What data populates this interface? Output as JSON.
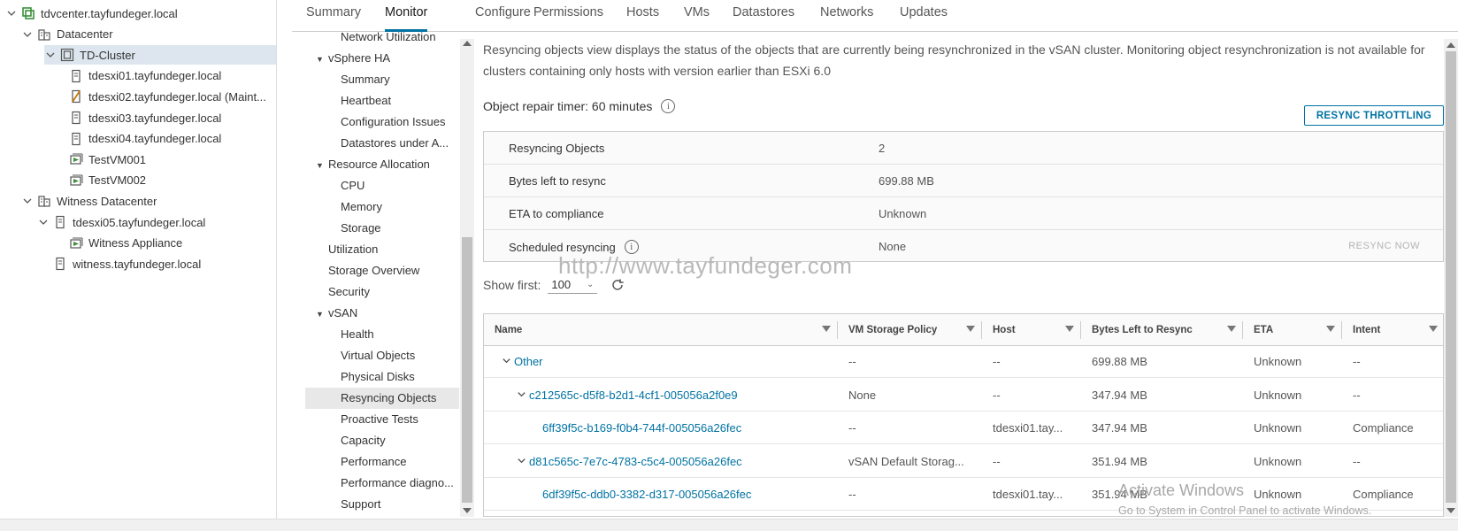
{
  "tree": [
    {
      "label": "tdvcenter.tayfundeger.local",
      "icon": "vcenter-icon",
      "level": 0,
      "toggle": "down"
    },
    {
      "label": "Datacenter",
      "icon": "datacenter-icon",
      "level": 1,
      "toggle": "down"
    },
    {
      "label": "TD-Cluster",
      "icon": "cluster-icon",
      "level": 2,
      "toggle": "down",
      "selected": true
    },
    {
      "label": "tdesxi01.tayfundeger.local",
      "icon": "host-icon",
      "level": 3
    },
    {
      "label": "tdesxi02.tayfundeger.local (Maint...",
      "icon": "host-maintenance-icon",
      "level": 3
    },
    {
      "label": "tdesxi03.tayfundeger.local",
      "icon": "host-icon",
      "level": 3
    },
    {
      "label": "tdesxi04.tayfundeger.local",
      "icon": "host-icon",
      "level": 3
    },
    {
      "label": "TestVM001",
      "icon": "vm-running-icon",
      "level": 3
    },
    {
      "label": "TestVM002",
      "icon": "vm-running-icon",
      "level": 3
    },
    {
      "label": "Witness Datacenter",
      "icon": "datacenter-icon",
      "level": 1,
      "toggle": "down"
    },
    {
      "label": "tdesxi05.tayfundeger.local",
      "icon": "host-icon",
      "level": 2,
      "toggle": "down"
    },
    {
      "label": "Witness Appliance",
      "icon": "vm-running-icon",
      "level": 3
    },
    {
      "label": "witness.tayfundeger.local",
      "icon": "host-icon",
      "level": 2
    }
  ],
  "tabs": [
    "Summary",
    "Monitor",
    "Configure",
    "Permissions",
    "Hosts",
    "VMs",
    "Datastores",
    "Networks",
    "Updates"
  ],
  "active_tab": "Monitor",
  "nav": [
    {
      "label": "Network Utilization",
      "indent": 1
    },
    {
      "label": "vSphere HA",
      "indent": 0,
      "caret": "▼"
    },
    {
      "label": "Summary",
      "indent": 1
    },
    {
      "label": "Heartbeat",
      "indent": 1
    },
    {
      "label": "Configuration Issues",
      "indent": 1
    },
    {
      "label": "Datastores under A...",
      "indent": 1
    },
    {
      "label": "Resource Allocation",
      "indent": 0,
      "caret": "▼"
    },
    {
      "label": "CPU",
      "indent": 1
    },
    {
      "label": "Memory",
      "indent": 1
    },
    {
      "label": "Storage",
      "indent": 1
    },
    {
      "label": "Utilization",
      "indent": 0
    },
    {
      "label": "Storage Overview",
      "indent": 0
    },
    {
      "label": "Security",
      "indent": 0
    },
    {
      "label": "vSAN",
      "indent": 0,
      "caret": "▼"
    },
    {
      "label": "Health",
      "indent": 1
    },
    {
      "label": "Virtual Objects",
      "indent": 1
    },
    {
      "label": "Physical Disks",
      "indent": 1
    },
    {
      "label": "Resyncing Objects",
      "indent": 1,
      "selected": true
    },
    {
      "label": "Proactive Tests",
      "indent": 1
    },
    {
      "label": "Capacity",
      "indent": 1
    },
    {
      "label": "Performance",
      "indent": 1
    },
    {
      "label": "Performance diagno...",
      "indent": 1
    },
    {
      "label": "Support",
      "indent": 1
    }
  ],
  "info_text": "Resyncing objects view displays the status of the objects that are currently being resynchronized in the vSAN cluster. Monitoring object resynchronization is not available for clusters containing only hosts with version earlier than ESXi 6.0",
  "repair_timer": "Object repair timer: 60 minutes",
  "resync_throttling": "RESYNC THROTTLING",
  "summary": [
    {
      "key": "Resyncing Objects",
      "value": "2"
    },
    {
      "key": "Bytes left to resync",
      "value": "699.88 MB"
    },
    {
      "key": "ETA to compliance",
      "value": "Unknown"
    },
    {
      "key": "Scheduled resyncing",
      "value": "None",
      "info": true
    }
  ],
  "resync_now": "RESYNC NOW",
  "watermark": "http://www.tayfundeger.com",
  "show_first_label": "Show first:",
  "show_first_value": "100",
  "columns": [
    "Name",
    "VM Storage Policy",
    "Host",
    "Bytes Left to Resync",
    "ETA",
    "Intent"
  ],
  "rows": [
    {
      "name": "Other",
      "level": 0,
      "chevron": true,
      "policy": "--",
      "host": "--",
      "bytes": "699.88 MB",
      "eta": "Unknown",
      "intent": "--"
    },
    {
      "name": "c212565c-d5f8-b2d1-4cf1-005056a2f0e9",
      "level": 1,
      "chevron": true,
      "policy": "None",
      "host": "--",
      "bytes": "347.94 MB",
      "eta": "Unknown",
      "intent": "--"
    },
    {
      "name": "6ff39f5c-b169-f0b4-744f-005056a26fec",
      "level": 2,
      "chevron": false,
      "policy": "--",
      "host": "tdesxi01.tay...",
      "bytes": "347.94 MB",
      "eta": "Unknown",
      "intent": "Compliance"
    },
    {
      "name": "d81c565c-7e7c-4783-c5c4-005056a26fec",
      "level": 1,
      "chevron": true,
      "policy": "vSAN Default Storag...",
      "host": "--",
      "bytes": "351.94 MB",
      "eta": "Unknown",
      "intent": "--"
    },
    {
      "name": "6df39f5c-ddb0-3382-d317-005056a26fec",
      "level": 2,
      "chevron": false,
      "policy": "--",
      "host": "tdesxi01.tay...",
      "bytes": "351.94 MB",
      "eta": "Unknown",
      "intent": "Compliance"
    }
  ],
  "activate_title": "Activate Windows",
  "activate_sub": "Go to System in Control Panel to activate Windows.",
  "colors": {
    "accent": "#0072a3",
    "selected_row": "#dde6ee",
    "vm_green": "#3c8f3c"
  }
}
